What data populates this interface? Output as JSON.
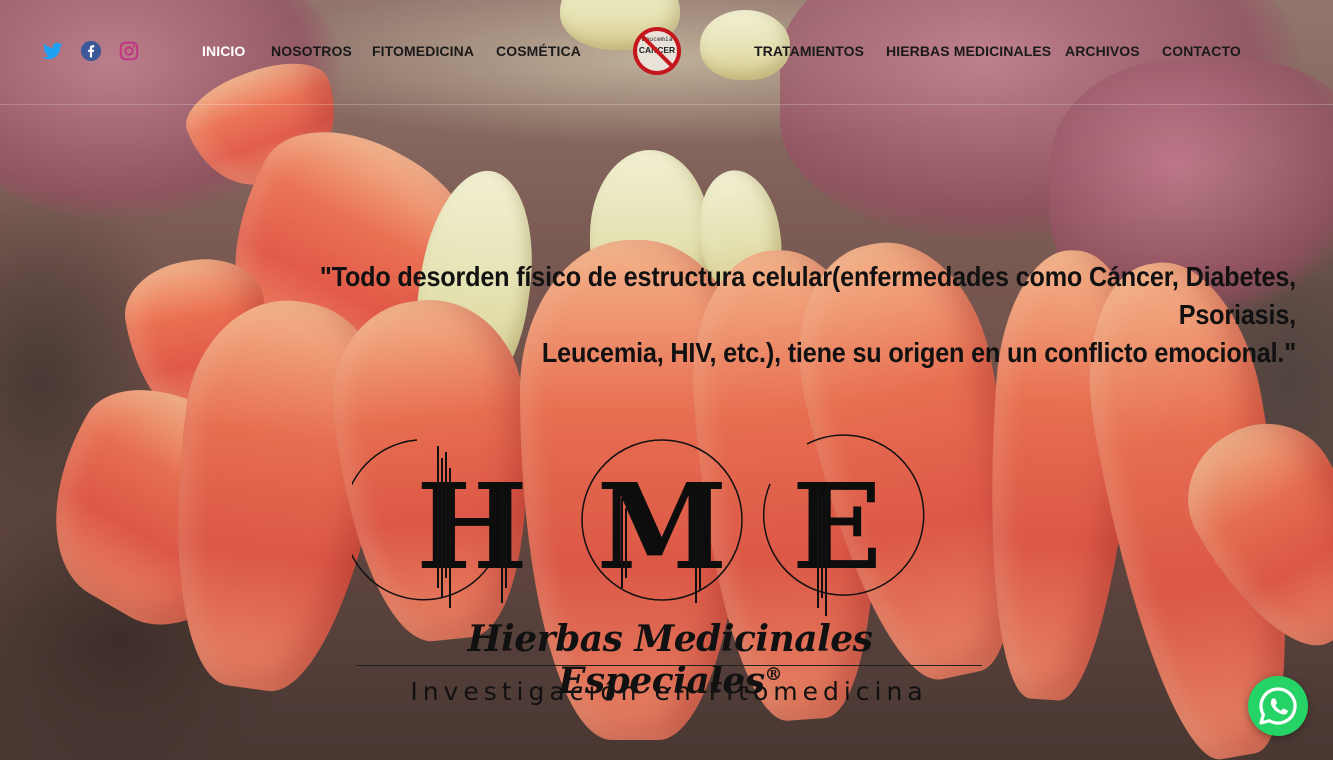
{
  "header": {
    "social": [
      {
        "icon": "twitter-icon",
        "color": "#1da1f2"
      },
      {
        "icon": "facebook-icon",
        "color": "#3b5998"
      },
      {
        "icon": "instagram-icon",
        "color": "#c13584"
      }
    ],
    "nav_left": [
      "INICIO",
      "NOSOTROS",
      "FITOMEDICINA",
      "COSMÉTICA"
    ],
    "nav_right": [
      "TRATAMIENTOS",
      "HIERBAS MEDICINALES",
      "ARCHIVOS",
      "CONTACTO"
    ],
    "active_item": "INICIO",
    "logo": {
      "line1": "Leucemia",
      "line2": "CANCER",
      "icon": "no-cancer-logo-icon"
    }
  },
  "hero": {
    "quote_line1": "\"Todo desorden físico de estructura celular(enfermedades como Cáncer, Diabetes, Psoriasis,",
    "quote_line2": "Leucemia, HIV, etc.), tiene su origen en un conflicto emocional.\""
  },
  "brand": {
    "letters": [
      "H",
      "M",
      "E"
    ],
    "name": "Hierbas Medicinales Especiales",
    "registered": "®",
    "tagline": "Investigación en Fitomedicina"
  },
  "whatsapp": {
    "icon": "whatsapp-icon",
    "color": "#25d366"
  }
}
